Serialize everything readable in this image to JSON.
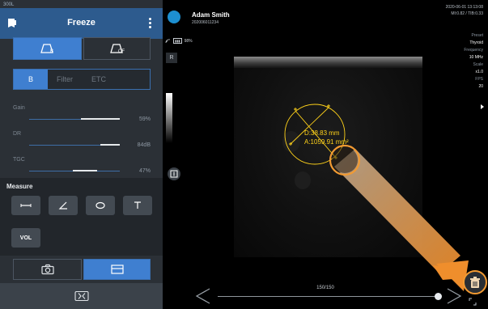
{
  "left_panel": {
    "top_label": "300L",
    "header": {
      "title": "Freeze"
    },
    "mode_buttons": {
      "b_label": "B",
      "cf_label": "CF"
    },
    "tabs": [
      "B",
      "Filter",
      "ETC",
      ""
    ],
    "sliders": [
      {
        "label": "Gain",
        "value": "59%"
      },
      {
        "label": "DR",
        "value": "84dB"
      },
      {
        "label": "TGC",
        "value": "47%"
      }
    ],
    "measure": {
      "title": "Measure",
      "vol_label": "VOL"
    }
  },
  "image": {
    "patient": {
      "name": "Adam Smith",
      "id": "202006011234"
    },
    "datetime": "2020-06-01 13:13:08",
    "mi_ti": "MI:0.82 / TIB:0.33",
    "status": {
      "battery": "98%"
    },
    "r_marker": "R",
    "params": [
      {
        "key": "Preset",
        "value": "Thyroid"
      },
      {
        "key": "Frequency",
        "value": "10 MHz"
      },
      {
        "key": "Scale",
        "value": "x1.0"
      },
      {
        "key": "FPS",
        "value": "20"
      }
    ],
    "measurement": {
      "distance": "D:38.83 mm",
      "area": "A:1059.91 mm²"
    },
    "frame_counter": "150/150"
  },
  "colors": {
    "accent_blue": "#3f7fd0",
    "header_blue": "#2d5b8e",
    "measure_yellow": "#ffd21a",
    "highlight_orange": "#f29a32"
  }
}
